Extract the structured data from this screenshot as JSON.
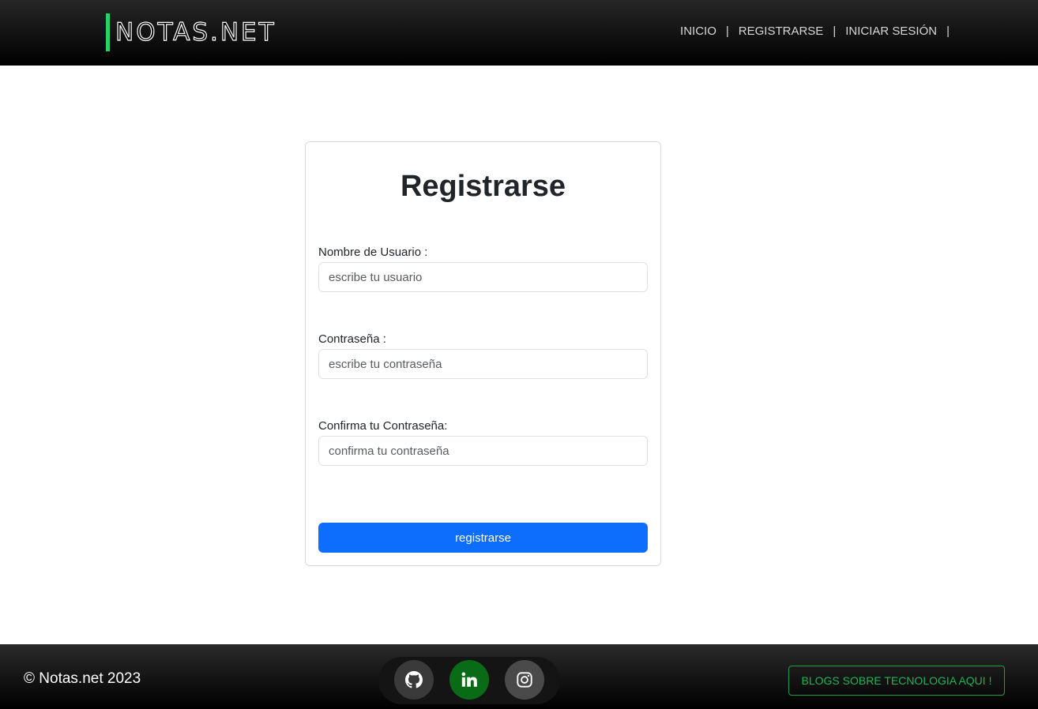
{
  "header": {
    "logo_text": "NOTAS.NET",
    "nav": [
      {
        "label": "INICIO",
        "sep": "|"
      },
      {
        "label": "REGISTRARSE",
        "sep": "|"
      },
      {
        "label": "INICIAR SESIÓN",
        "sep": "|"
      }
    ]
  },
  "form": {
    "title": "Registrarse",
    "username": {
      "label": "Nombre de Usuario :",
      "placeholder": "escribe tu usuario",
      "value": ""
    },
    "password": {
      "label": "Contraseña :",
      "placeholder": "escribe tu contraseña",
      "value": ""
    },
    "confirm": {
      "label": "Confirma tu Contraseña:",
      "placeholder": "confirma tu contraseña",
      "value": ""
    },
    "submit_label": "registrarse"
  },
  "footer": {
    "copyright": "© Notas.net 2023",
    "social": [
      {
        "name": "github-icon",
        "color": "#3a3a3a"
      },
      {
        "name": "linkedin-icon",
        "color": "#0a6b16"
      },
      {
        "name": "instagram-icon",
        "color": "#4a4a4a"
      }
    ],
    "blog_button": "BLOGS SOBRE TECNOLOGIA AQUI !"
  },
  "colors": {
    "accent_green": "#1fd65f",
    "primary_blue": "#0d6efd"
  }
}
